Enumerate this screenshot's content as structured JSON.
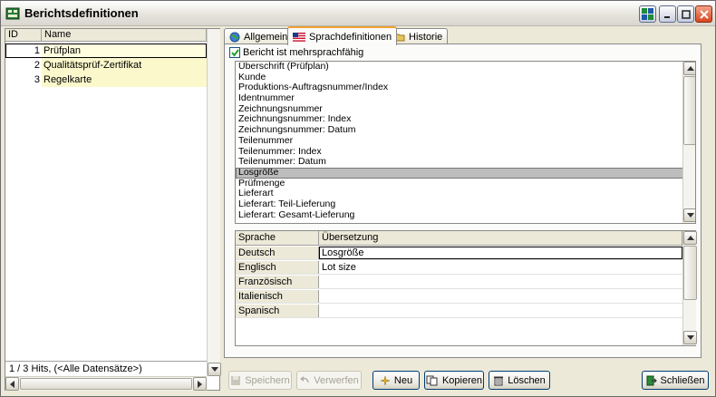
{
  "window": {
    "title": "Berichtsdefinitionen"
  },
  "left_grid": {
    "headers": [
      "ID",
      "Name"
    ],
    "rows": [
      {
        "id": "1",
        "name": "Prüfplan"
      },
      {
        "id": "2",
        "name": "Qualitätsprüf-Zertifikat"
      },
      {
        "id": "3",
        "name": "Regelkarte"
      }
    ],
    "status": "1 / 3 Hits, (<Alle Datensätze>)"
  },
  "tabs": [
    {
      "label": "Allgemein",
      "icon": "globe-icon"
    },
    {
      "label": "Sprachdefinitionen",
      "icon": "flag-icon"
    },
    {
      "label": "Historie",
      "icon": "folder-icon"
    }
  ],
  "multilang_label": "Bericht ist mehrsprachfähig",
  "field_list": [
    "Überschrift (Prüfplan)",
    "Kunde",
    "Produktions-Auftragsnummer/Index",
    "Identnummer",
    "Zeichnungsnummer",
    "Zeichnungsnummer: Index",
    "Zeichnungsnummer: Datum",
    "Teilenummer",
    "Teilenummer: Index",
    "Teilenummer: Datum",
    "Losgröße",
    "Prüfmenge",
    "Lieferart",
    "Lieferart: Teil-Lieferung",
    "Lieferart: Gesamt-Lieferung"
  ],
  "selected_field_index": 10,
  "translation_grid": {
    "headers": [
      "Sprache",
      "Übersetzung"
    ],
    "rows": [
      {
        "lang": "Deutsch",
        "text": "Losgröße"
      },
      {
        "lang": "Englisch",
        "text": "Lot size"
      },
      {
        "lang": "Französisch",
        "text": ""
      },
      {
        "lang": "Italienisch",
        "text": ""
      },
      {
        "lang": "Spanisch",
        "text": ""
      }
    ]
  },
  "buttons": {
    "save": "Speichern",
    "discard": "Verwerfen",
    "new": "Neu",
    "copy": "Kopieren",
    "delete": "Löschen",
    "close": "Schließen"
  }
}
